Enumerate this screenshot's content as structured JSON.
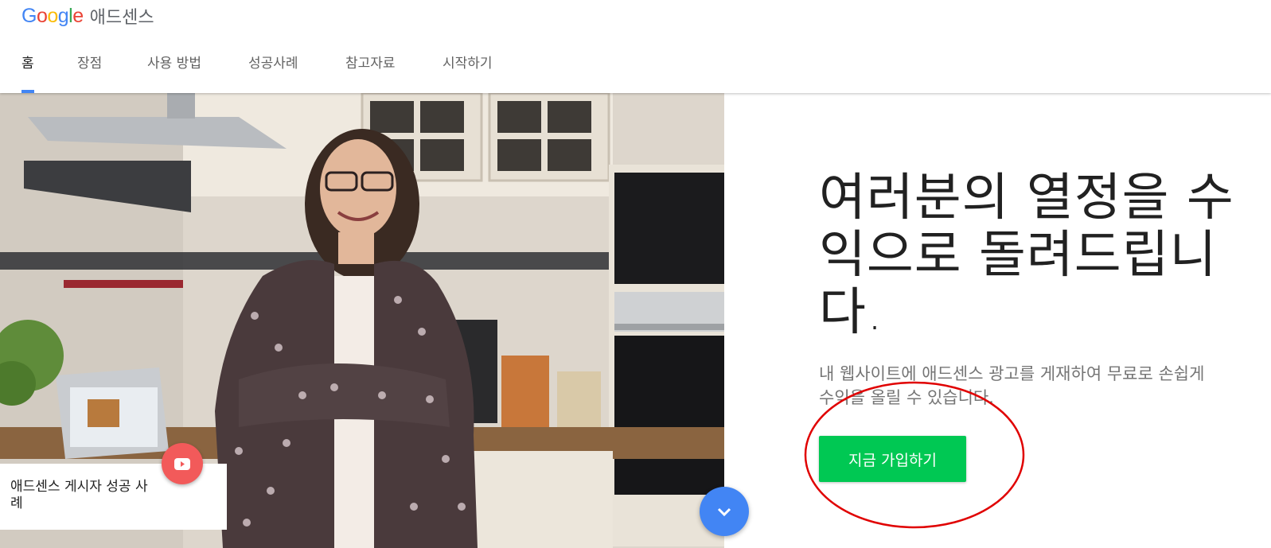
{
  "brand": {
    "logo_letters": [
      "G",
      "o",
      "o",
      "g",
      "l",
      "e"
    ],
    "logo_colors": [
      "#4285F4",
      "#EA4335",
      "#FBBC05",
      "#4285F4",
      "#34A853",
      "#EA4335"
    ],
    "product_name": "애드센스"
  },
  "nav": {
    "tabs": [
      {
        "label": "홈",
        "active": true
      },
      {
        "label": "장점",
        "active": false
      },
      {
        "label": "사용 방법",
        "active": false
      },
      {
        "label": "성공사례",
        "active": false
      },
      {
        "label": "참고자료",
        "active": false
      },
      {
        "label": "시작하기",
        "active": false
      }
    ],
    "active_indicator_color": "#4285F4"
  },
  "hero": {
    "case_study_label": "애드센스 게시자 성공 사례",
    "play_icon": "youtube-play-icon",
    "scroll_icon": "chevron-down-icon"
  },
  "main": {
    "headline": "여러분의 열정을 수익으로 돌려드립니다.",
    "subtext": "내 웹사이트에 애드센스 광고를 게재하여 무료로 손쉽게 수익을 올릴 수 있습니다.",
    "signup_button": "지금 가입하기",
    "signup_button_color": "#00C853"
  },
  "annotation": {
    "shape": "ellipse",
    "color": "#E00000",
    "target": "signup-button"
  }
}
